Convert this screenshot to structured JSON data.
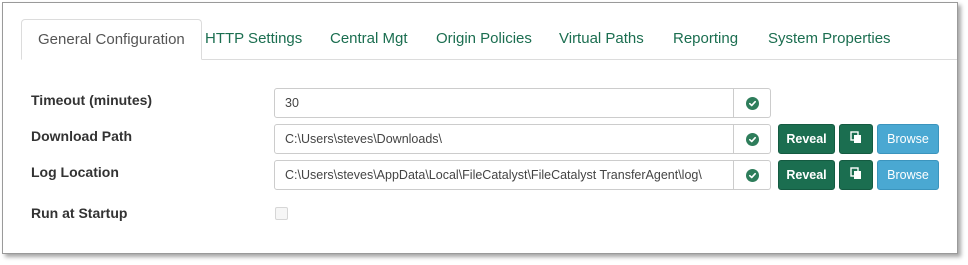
{
  "tabs": [
    {
      "label": "General Configuration",
      "active": true
    },
    {
      "label": "HTTP Settings"
    },
    {
      "label": "Central Mgt"
    },
    {
      "label": "Origin Policies"
    },
    {
      "label": "Virtual Paths"
    },
    {
      "label": "Reporting"
    },
    {
      "label": "System Properties"
    }
  ],
  "fields": {
    "timeout": {
      "label": "Timeout (minutes)",
      "value": "30",
      "status_icon": "check-circle-icon"
    },
    "download_path": {
      "label": "Download Path",
      "value": "C:\\Users\\steves\\Downloads\\",
      "status_icon": "check-circle-icon"
    },
    "log_location": {
      "label": "Log Location",
      "value": "C:\\Users\\steves\\AppData\\Local\\FileCatalyst\\FileCatalyst TransferAgent\\log\\",
      "status_icon": "check-circle-icon"
    },
    "run_at_startup": {
      "label": "Run at Startup",
      "checked": false
    }
  },
  "buttons": {
    "reveal_label": "Reveal",
    "copy_icon": "copy-icon",
    "browse_label": "Browse"
  },
  "colors": {
    "accent_green": "#1b6e50",
    "status_green": "#2e7d5b",
    "browse_blue": "#4aa8d2"
  }
}
